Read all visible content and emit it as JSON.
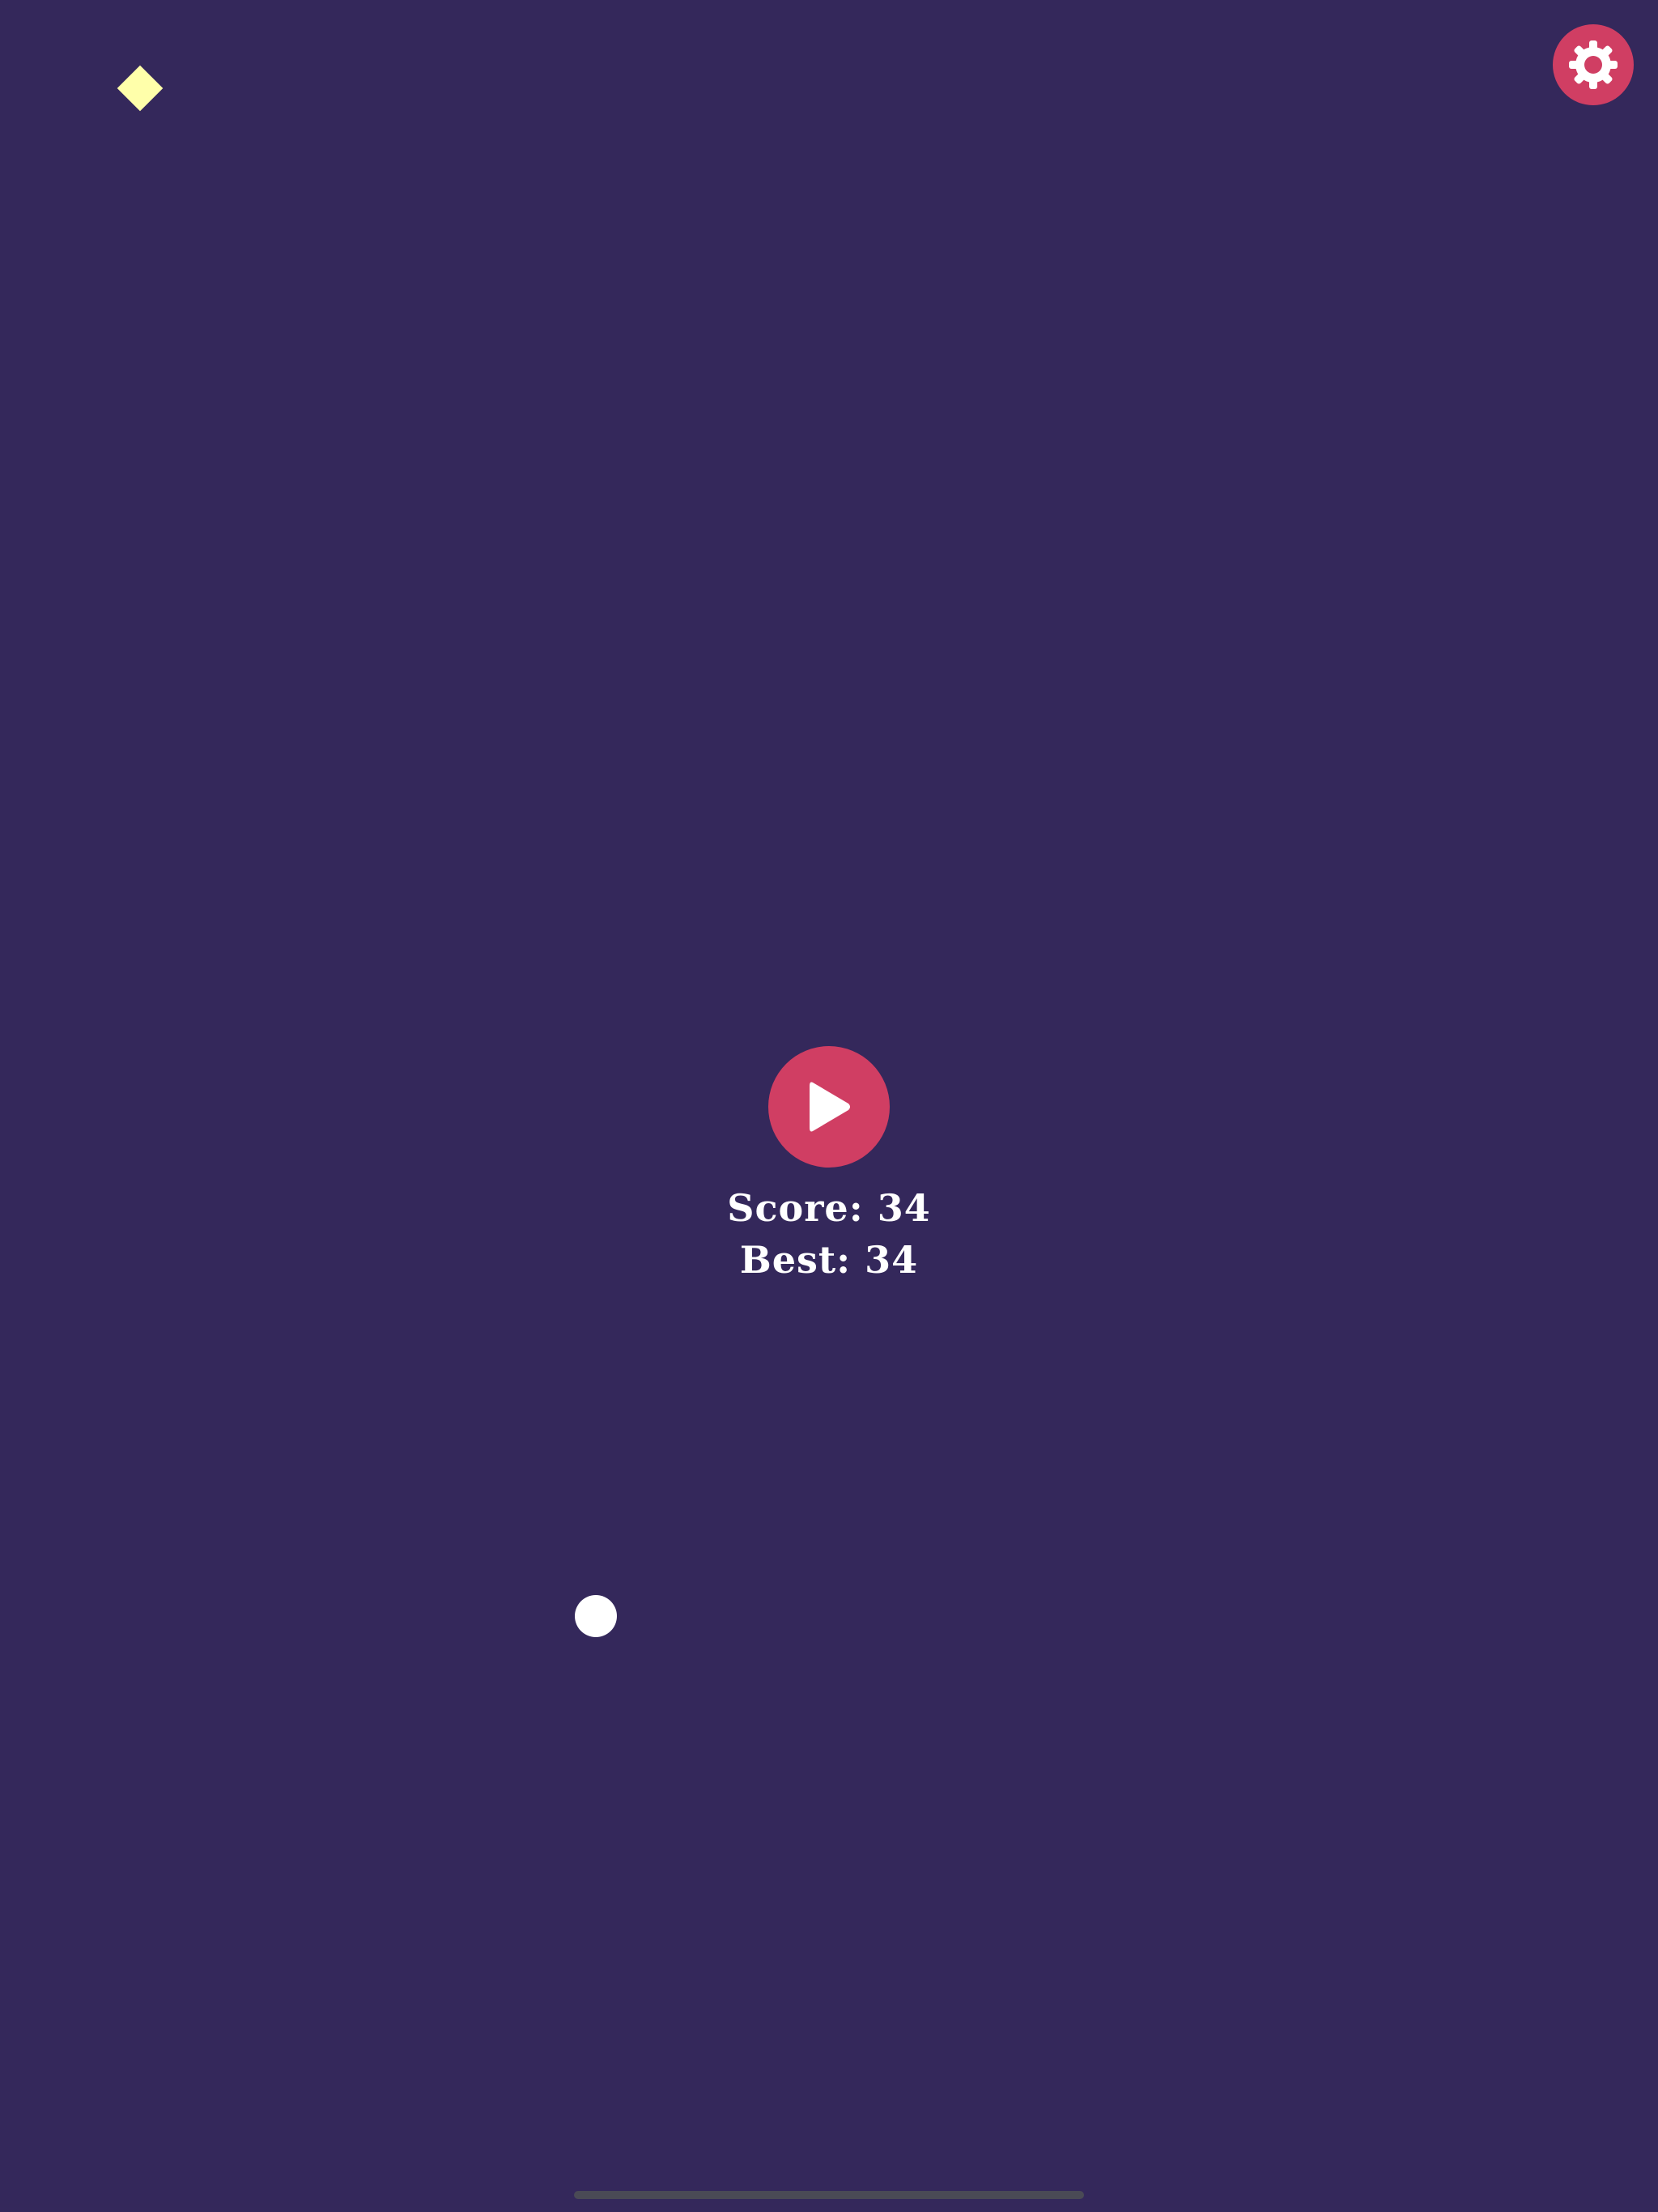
{
  "game": {
    "score_label": "Score: 34",
    "best_label": "Best: 34",
    "score": 34,
    "best": 34
  },
  "colors": {
    "background": "#34285b",
    "accent": "#d03e63",
    "collectible": "#ffffaa",
    "ball": "#ffffff",
    "text": "#ffffff"
  },
  "icons": {
    "settings": "gear-icon",
    "play": "play-icon",
    "collectible": "diamond-icon",
    "ball": "ball-icon"
  }
}
